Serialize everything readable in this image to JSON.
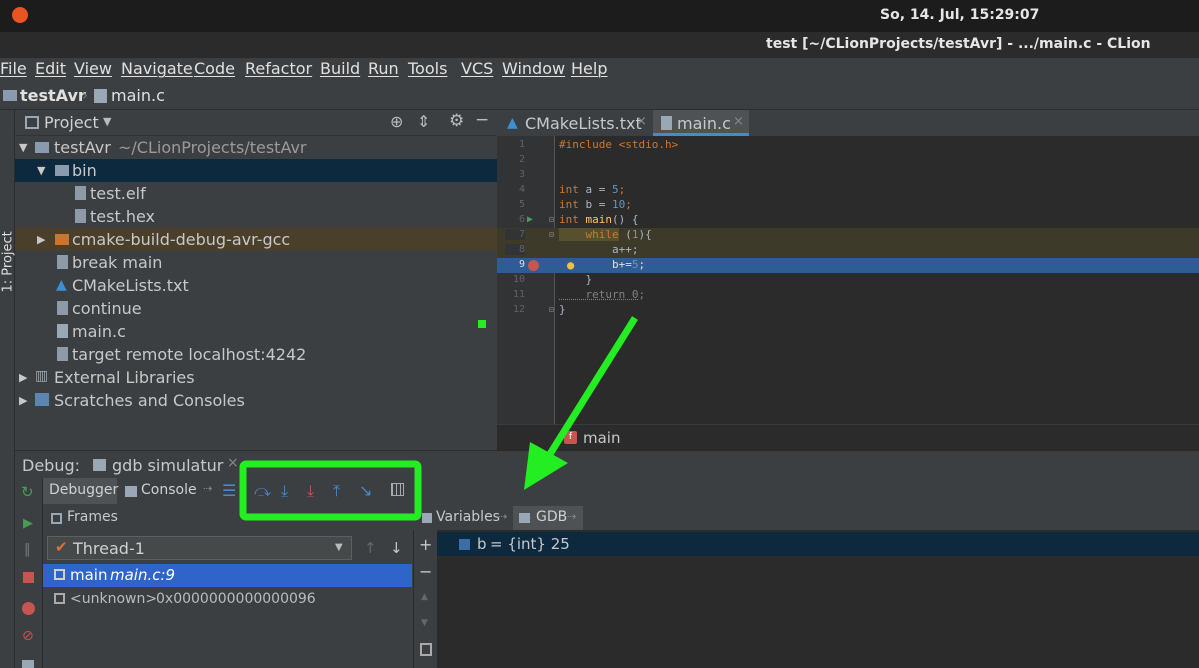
{
  "system": {
    "clock": "So, 14. Jul, 15:29:07"
  },
  "window": {
    "title": "test [~/CLionProjects/testAvr] - .../main.c - CLion"
  },
  "menu": [
    "File",
    "Edit",
    "View",
    "Navigate",
    "Code",
    "Refactor",
    "Build",
    "Run",
    "Tools",
    "VCS",
    "Window",
    "Help"
  ],
  "breadcrumb": {
    "project": "testAvr",
    "file": "main.c"
  },
  "side_tab": "1: Project",
  "project_panel": {
    "title": "Project",
    "tree": [
      {
        "label": "testAvr",
        "extra": "~/CLionProjects/testAvr"
      },
      {
        "label": "bin"
      },
      {
        "label": "test.elf"
      },
      {
        "label": "test.hex"
      },
      {
        "label": "cmake-build-debug-avr-gcc"
      },
      {
        "label": "break main"
      },
      {
        "label": "CMakeLists.txt"
      },
      {
        "label": "continue"
      },
      {
        "label": "main.c"
      },
      {
        "label": "target remote localhost:4242"
      },
      {
        "label": "External Libraries"
      },
      {
        "label": "Scratches and Consoles"
      }
    ]
  },
  "editor": {
    "tabs": [
      "CMakeLists.txt",
      "main.c"
    ],
    "lines": [
      "1",
      "2",
      "3",
      "4",
      "5",
      "6",
      "7",
      "8",
      "9",
      "10",
      "11",
      "12"
    ],
    "code": {
      "l1": "#include <stdio.h>",
      "l4a": "int",
      "l4b": " a = ",
      "l4c": "5",
      "l4d": ";",
      "l5a": "int",
      "l5b": " b = ",
      "l5c": "10",
      "l5d": ";",
      "l6a": "int ",
      "l6b": "main",
      "l6c": "() {",
      "l7a": "    while",
      "l7b": " (",
      "l7c": "1",
      "l7d": "){",
      "l8": "        a++;",
      "l9a": "        b+=",
      "l9b": "5",
      "l9c": ";",
      "l10": "    }",
      "l11a": "    return ",
      "l11b": "0",
      "l11c": ";",
      "l12": "}"
    },
    "function_crumb": "main"
  },
  "debug": {
    "label": "Debug:",
    "config": "gdb simulatur",
    "tabs": {
      "debugger": "Debugger",
      "console": "Console"
    },
    "frames_title": "Frames",
    "thread": "Thread-1",
    "frames": [
      {
        "name": "main",
        "loc": "main.c:9"
      },
      {
        "name": "<unknown>",
        "loc": "0x0000000000000096"
      }
    ],
    "vars_tab": "Variables",
    "gdb_tab": "GDB",
    "variable": {
      "name": "b",
      "value": "= {int} 25"
    }
  },
  "annotation_color": "#22ee22"
}
